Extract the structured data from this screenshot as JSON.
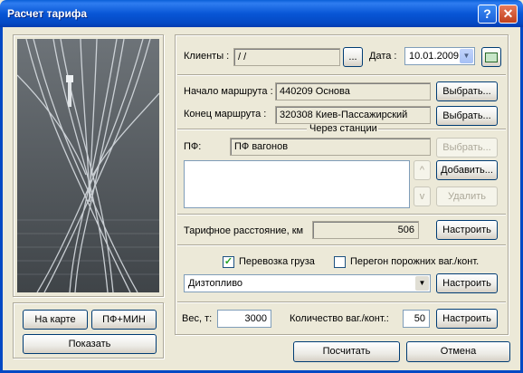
{
  "window": {
    "title": "Расчет тарифа"
  },
  "left": {
    "map_button": "На карте",
    "pf_button": "ПФ+МИН",
    "show_button": "Показать"
  },
  "clients": {
    "label": "Клиенты :",
    "value": "/ /",
    "browse": "...",
    "date_label": "Дата :",
    "date_value": "10.01.2009"
  },
  "route": {
    "start_label": "Начало маршрута :",
    "start_value": "440209  Основа",
    "start_button": "Выбрать...",
    "end_label": "Конец   маршрута :",
    "end_value": "320308  Киев-Пассажирский",
    "end_button": "Выбрать..."
  },
  "via": {
    "group_label": "Через станции",
    "pf_label": "ПФ:",
    "pf_value": "ПФ вагонов",
    "pf_button": "Выбрать...",
    "up_glyph": "^",
    "down_glyph": "v",
    "add_button": "Добавить...",
    "delete_button": "Удалить"
  },
  "distance": {
    "label": "Тарифное расстояние, км",
    "value": "506",
    "button": "Настроить"
  },
  "cargo": {
    "transport_label": "Перевозка груза",
    "transport_checked": true,
    "empty_label": "Перегон порожних ваг./конт.",
    "empty_checked": false,
    "cargo_value": "Дизтопливо",
    "cargo_button": "Настроить"
  },
  "weight": {
    "label": "Вес, т:",
    "value": "3000",
    "count_label": "Количество ваг./конт.:",
    "count_value": "50",
    "button": "Настроить"
  },
  "footer": {
    "calc_button": "Посчитать",
    "cancel_button": "Отмена"
  }
}
